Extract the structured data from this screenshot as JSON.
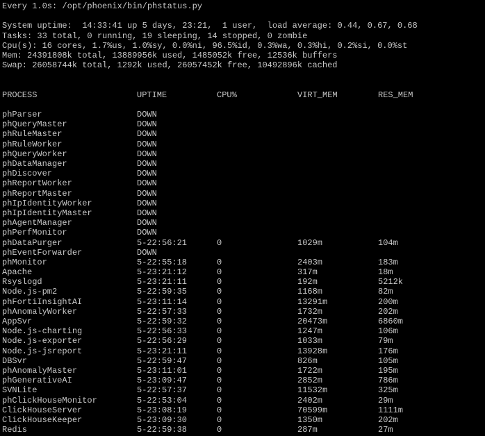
{
  "watch_header": "Every 1.0s: /opt/phoenix/bin/phstatus.py",
  "summary": [
    "System uptime:  14:33:41 up 5 days, 23:21,  1 user,  load average: 0.44, 0.67, 0.68",
    "Tasks: 33 total, 0 running, 19 sleeping, 14 stopped, 0 zombie",
    "Cpu(s): 16 cores, 1.7%us, 1.0%sy, 0.0%ni, 96.5%id, 0.3%wa, 0.3%hi, 0.2%si, 0.0%st",
    "Mem: 24391808k total, 13889956k used, 1485052k free, 12536k buffers",
    "Swap: 26058744k total, 1292k used, 26057452k free, 10492896k cached"
  ],
  "table": {
    "headers": {
      "process": "PROCESS",
      "uptime": "UPTIME",
      "cpu": "CPU%",
      "virt": "VIRT_MEM",
      "res": "RES_MEM"
    },
    "rows": [
      {
        "name": "phParser",
        "uptime": "DOWN",
        "cpu": "",
        "virt": "",
        "res": ""
      },
      {
        "name": "phQueryMaster",
        "uptime": "DOWN",
        "cpu": "",
        "virt": "",
        "res": ""
      },
      {
        "name": "phRuleMaster",
        "uptime": "DOWN",
        "cpu": "",
        "virt": "",
        "res": ""
      },
      {
        "name": "phRuleWorker",
        "uptime": "DOWN",
        "cpu": "",
        "virt": "",
        "res": ""
      },
      {
        "name": "phQueryWorker",
        "uptime": "DOWN",
        "cpu": "",
        "virt": "",
        "res": ""
      },
      {
        "name": "phDataManager",
        "uptime": "DOWN",
        "cpu": "",
        "virt": "",
        "res": ""
      },
      {
        "name": "phDiscover",
        "uptime": "DOWN",
        "cpu": "",
        "virt": "",
        "res": ""
      },
      {
        "name": "phReportWorker",
        "uptime": "DOWN",
        "cpu": "",
        "virt": "",
        "res": ""
      },
      {
        "name": "phReportMaster",
        "uptime": "DOWN",
        "cpu": "",
        "virt": "",
        "res": ""
      },
      {
        "name": "phIpIdentityWorker",
        "uptime": "DOWN",
        "cpu": "",
        "virt": "",
        "res": ""
      },
      {
        "name": "phIpIdentityMaster",
        "uptime": "DOWN",
        "cpu": "",
        "virt": "",
        "res": ""
      },
      {
        "name": "phAgentManager",
        "uptime": "DOWN",
        "cpu": "",
        "virt": "",
        "res": ""
      },
      {
        "name": "phPerfMonitor",
        "uptime": "DOWN",
        "cpu": "",
        "virt": "",
        "res": ""
      },
      {
        "name": "phDataPurger",
        "uptime": "5-22:56:21",
        "cpu": "0",
        "virt": "1029m",
        "res": "104m"
      },
      {
        "name": "phEventForwarder",
        "uptime": "DOWN",
        "cpu": "",
        "virt": "",
        "res": ""
      },
      {
        "name": "phMonitor",
        "uptime": "5-22:55:18",
        "cpu": "0",
        "virt": "2403m",
        "res": "183m"
      },
      {
        "name": "Apache",
        "uptime": "5-23:21:12",
        "cpu": "0",
        "virt": "317m",
        "res": "18m"
      },
      {
        "name": "Rsyslogd",
        "uptime": "5-23:21:11",
        "cpu": "0",
        "virt": "192m",
        "res": "5212k"
      },
      {
        "name": "Node.js-pm2",
        "uptime": "5-22:59:35",
        "cpu": "0",
        "virt": "1168m",
        "res": "82m"
      },
      {
        "name": "phFortiInsightAI",
        "uptime": "5-23:11:14",
        "cpu": "0",
        "virt": "13291m",
        "res": "200m"
      },
      {
        "name": "phAnomalyWorker",
        "uptime": "5-22:57:33",
        "cpu": "0",
        "virt": "1732m",
        "res": "202m"
      },
      {
        "name": "AppSvr",
        "uptime": "5-22:59:32",
        "cpu": "0",
        "virt": "20473m",
        "res": "6860m"
      },
      {
        "name": "Node.js-charting",
        "uptime": "5-22:56:33",
        "cpu": "0",
        "virt": "1247m",
        "res": "106m"
      },
      {
        "name": "Node.js-exporter",
        "uptime": "5-22:56:29",
        "cpu": "0",
        "virt": "1033m",
        "res": "79m"
      },
      {
        "name": "Node.js-jsreport",
        "uptime": "5-23:21:11",
        "cpu": "0",
        "virt": "13928m",
        "res": "176m"
      },
      {
        "name": "DBSvr",
        "uptime": "5-22:59:47",
        "cpu": "0",
        "virt": "826m",
        "res": "105m"
      },
      {
        "name": "phAnomalyMaster",
        "uptime": "5-23:11:01",
        "cpu": "0",
        "virt": "1722m",
        "res": "195m"
      },
      {
        "name": "phGenerativeAI",
        "uptime": "5-23:09:47",
        "cpu": "0",
        "virt": "2852m",
        "res": "786m"
      },
      {
        "name": "SVNLite",
        "uptime": "5-22:57:37",
        "cpu": "0",
        "virt": "11532m",
        "res": "325m"
      },
      {
        "name": "phClickHouseMonitor",
        "uptime": "5-22:53:04",
        "cpu": "0",
        "virt": "2402m",
        "res": "29m"
      },
      {
        "name": "ClickHouseServer",
        "uptime": "5-23:08:19",
        "cpu": "0",
        "virt": "70599m",
        "res": "1111m"
      },
      {
        "name": "ClickHouseKeeper",
        "uptime": "5-23:09:30",
        "cpu": "0",
        "virt": "1350m",
        "res": "202m"
      },
      {
        "name": "Redis",
        "uptime": "5-22:59:38",
        "cpu": "0",
        "virt": "287m",
        "res": "27m"
      }
    ]
  },
  "colors": {
    "background": "#000000",
    "text": "#c8c8c8"
  }
}
